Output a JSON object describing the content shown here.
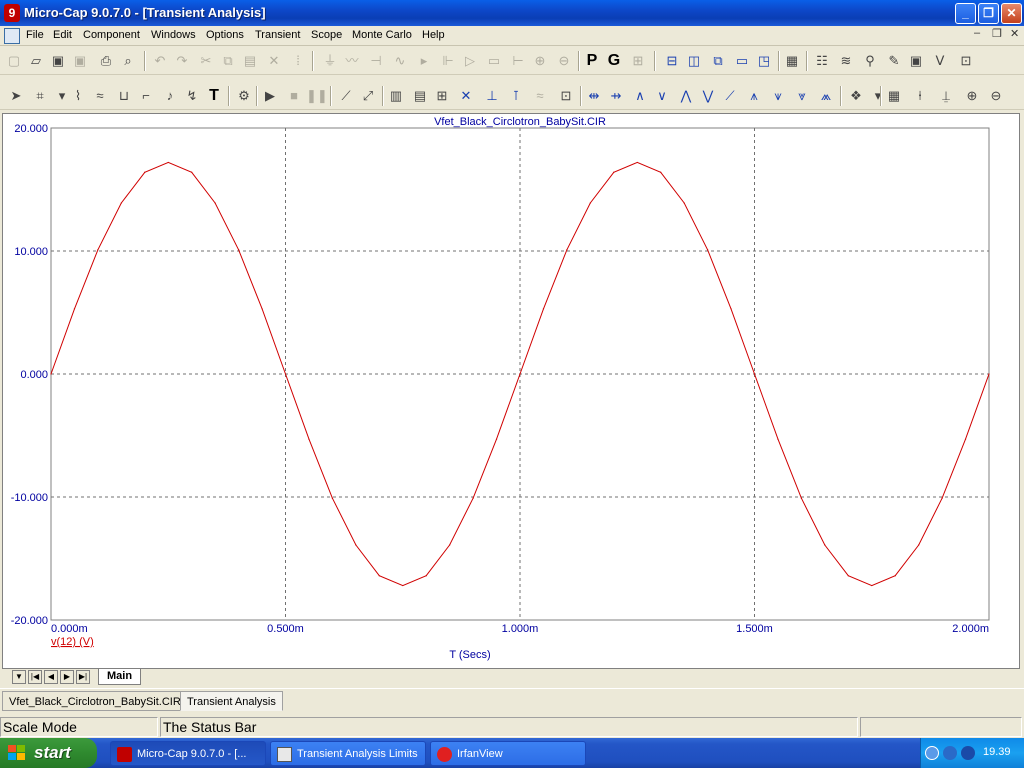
{
  "window": {
    "title": "Micro-Cap 9.0.7.0 - [Transient Analysis]",
    "minimize": "_",
    "restore": "❐",
    "close": "✕"
  },
  "menu": {
    "items": [
      "File",
      "Edit",
      "Component",
      "Windows",
      "Options",
      "Transient",
      "Scope",
      "Monte Carlo",
      "Help"
    ],
    "mdi_minimize": "–",
    "mdi_restore": "❐",
    "mdi_close": "✕"
  },
  "toolbar1": {
    "p_label": "P",
    "g_label": "G"
  },
  "toolbar2": {
    "text_tool": "T"
  },
  "plot": {
    "title": "Vfet_Black_Circlotron_BabySit.CIR",
    "trace_label": "v(12) (V)",
    "trace_color": "#d00000",
    "axis_color": "#0000a0"
  },
  "chart_data": {
    "type": "line",
    "title": "Vfet_Black_Circlotron_BabySit.CIR",
    "xlabel": "T (Secs)",
    "ylabel": "",
    "xlim": [
      0,
      2.0
    ],
    "ylim": [
      -20,
      20
    ],
    "x_ticks": [
      0,
      0.5,
      1.0,
      1.5,
      2.0
    ],
    "x_tick_labels": [
      "0.000m",
      "0.500m",
      "1.000m",
      "1.500m",
      "2.000m"
    ],
    "y_ticks": [
      -20,
      -10,
      0,
      10,
      20
    ],
    "y_tick_labels": [
      "-20.000",
      "-10.000",
      "0.000",
      "10.000",
      "20.000"
    ],
    "grid": true,
    "series": [
      {
        "name": "v(12) (V)",
        "color": "#d00000",
        "x": [
          0,
          0.05,
          0.1,
          0.15,
          0.2,
          0.25,
          0.3,
          0.35,
          0.4,
          0.45,
          0.5,
          0.55,
          0.6,
          0.65,
          0.7,
          0.75,
          0.8,
          0.85,
          0.9,
          0.95,
          1.0,
          1.05,
          1.1,
          1.15,
          1.2,
          1.25,
          1.3,
          1.35,
          1.4,
          1.45,
          1.5,
          1.55,
          1.6,
          1.65,
          1.7,
          1.75,
          1.8,
          1.85,
          1.9,
          1.95,
          2.0
        ],
        "values": [
          0,
          5.3,
          10.1,
          13.9,
          16.4,
          17.2,
          16.4,
          13.9,
          10.1,
          5.3,
          0,
          -5.3,
          -10.1,
          -13.9,
          -16.4,
          -17.2,
          -16.4,
          -13.9,
          -10.1,
          -5.3,
          0,
          5.3,
          10.1,
          13.9,
          16.4,
          17.2,
          16.4,
          13.9,
          10.1,
          5.3,
          0,
          -5.3,
          -10.1,
          -13.9,
          -16.4,
          -17.2,
          -16.4,
          -13.9,
          -10.1,
          -5.3,
          0
        ]
      }
    ]
  },
  "tabs": {
    "main": "Main",
    "documents": [
      "Vfet_Black_Circlotron_BabySit.CIR",
      "Transient Analysis"
    ]
  },
  "status": {
    "mode": "Scale Mode",
    "message": "The Status Bar"
  },
  "taskbar": {
    "start": "start",
    "tasks": [
      "Micro-Cap 9.0.7.0 - [...",
      "Transient Analysis Limits",
      "IrfanView"
    ],
    "clock": "19.39"
  }
}
